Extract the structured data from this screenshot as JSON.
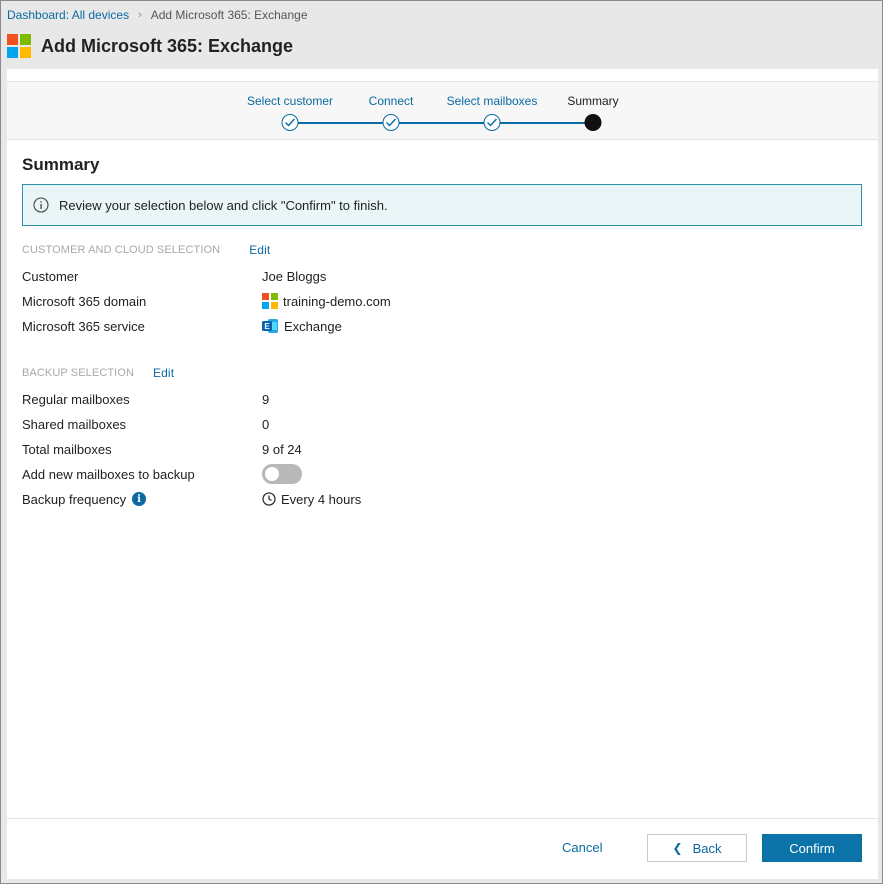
{
  "breadcrumb": {
    "parent": "Dashboard: All devices",
    "current": "Add Microsoft 365: Exchange"
  },
  "title": "Add Microsoft 365: Exchange",
  "stepper": {
    "steps": [
      {
        "label": "Select customer",
        "state": "done"
      },
      {
        "label": "Connect",
        "state": "done"
      },
      {
        "label": "Select mailboxes",
        "state": "done"
      },
      {
        "label": "Summary",
        "state": "current"
      }
    ]
  },
  "summary": {
    "heading": "Summary",
    "info_message": "Review your selection below and click \"Confirm\" to finish."
  },
  "customer_section": {
    "header": "CUSTOMER AND CLOUD SELECTION",
    "edit_label": "Edit",
    "rows": [
      {
        "label": "Customer",
        "value": "Joe Bloggs"
      },
      {
        "label": "Microsoft 365 domain",
        "value": "training-demo.com"
      },
      {
        "label": "Microsoft 365 service",
        "value": "Exchange"
      }
    ]
  },
  "backup_section": {
    "header": "BACKUP SELECTION",
    "edit_label": "Edit",
    "rows": [
      {
        "label": "Regular mailboxes",
        "value": "9"
      },
      {
        "label": "Shared mailboxes",
        "value": "0"
      },
      {
        "label": "Total mailboxes",
        "value": "9 of 24"
      },
      {
        "label": "Add new mailboxes to backup",
        "toggle_on": false
      },
      {
        "label": "Backup frequency",
        "value": "Every 4 hours"
      }
    ]
  },
  "footer": {
    "cancel_label": "Cancel",
    "back_label": "Back",
    "confirm_label": "Confirm"
  },
  "colors": {
    "accent": "#0b6aa2",
    "confirm_bg": "#0b73a8",
    "info_bg": "#eaf5f8",
    "info_border": "#2f8fa8",
    "ms_red": "#f25022",
    "ms_green": "#7fba00",
    "ms_blue": "#00a4ef",
    "ms_yellow": "#ffb900"
  },
  "icons": {
    "app_logo": "microsoft-logo-icon",
    "info": "info-circle-icon",
    "domain": "microsoft-logo-icon",
    "service": "exchange-icon",
    "frequency_help": "info-filled-icon",
    "clock": "clock-icon",
    "back": "chevron-left-icon"
  }
}
